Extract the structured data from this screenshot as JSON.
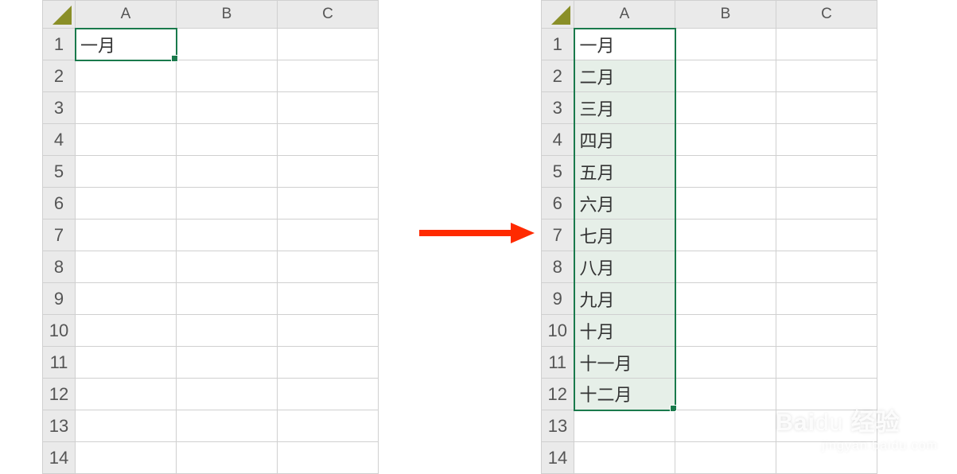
{
  "columns": [
    "A",
    "B",
    "C"
  ],
  "row_count": 14,
  "left_sheet": {
    "selected_cell": "A1",
    "cells": {
      "A1": "一月"
    }
  },
  "right_sheet": {
    "selected_range": "A1:A12",
    "cells": {
      "A1": "一月",
      "A2": "二月",
      "A3": "三月",
      "A4": "四月",
      "A5": "五月",
      "A6": "六月",
      "A7": "七月",
      "A8": "八月",
      "A9": "九月",
      "A10": "十月",
      "A11": "十一月",
      "A12": "十二月"
    }
  },
  "watermark": {
    "brand_part1": "Bai",
    "brand_part2": "du",
    "brand_suffix": "经验",
    "url": "jingyan.baidu.com"
  }
}
